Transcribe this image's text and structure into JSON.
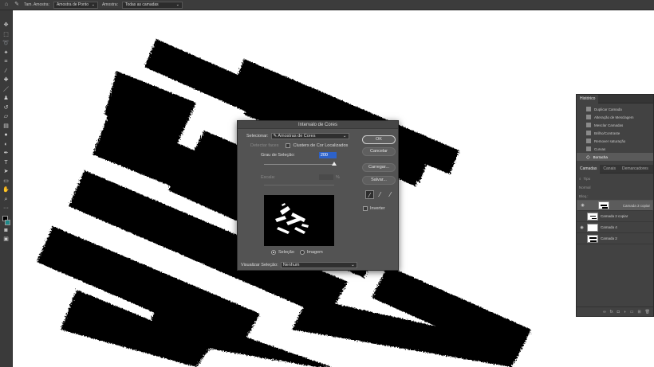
{
  "options_bar": {
    "sample_size_label": "Tam. Amostra:",
    "sample_size_value": "Amostra de Ponto",
    "sample_label": "Amostra:",
    "sample_value": "Todas as camadas"
  },
  "tools": [
    "move-icon",
    "marquee-icon",
    "lasso-icon",
    "quick-select-icon",
    "crop-icon",
    "eyedropper-icon",
    "healing-icon",
    "brush-icon",
    "stamp-icon",
    "history-brush-icon",
    "eraser-icon",
    "gradient-icon",
    "blur-icon",
    "dodge-icon",
    "pen-icon",
    "type-icon",
    "path-select-icon",
    "rectangle-icon",
    "hand-icon",
    "zoom-icon",
    "more-icon"
  ],
  "dialog": {
    "title": "Intervalo de Cores",
    "select_label": "Selecionar:",
    "select_value": "Amostras de Cores",
    "detect_faces": "Detectar faces",
    "localized_clusters": "Clusters de Cor Localizados",
    "fuzziness_label": "Grau de Seleção:",
    "fuzziness_value": "200",
    "range_label": "Escala:",
    "range_unit": "%",
    "fuzziness_level": 1.0,
    "radio_selection": "Seleção",
    "radio_image": "Imagem",
    "preview_label": "Visualizar Seleção:",
    "preview_value": "Nenhum",
    "ok": "OK",
    "cancel": "Cancelar",
    "load": "Carregar...",
    "save": "Salvar...",
    "invert": "Inverter"
  },
  "history": {
    "tab": "Histórico",
    "items": [
      "Duplicar Camada",
      "Alteração de Mesclagem",
      "Mesclar Camadas",
      "Brilho/Contraste",
      "Remover saturação",
      "Curvas",
      "Borracha"
    ]
  },
  "layers": {
    "tabs": [
      "Camadas",
      "Canais",
      "Demarcadores"
    ],
    "search": "Tipo",
    "blend": "Normal",
    "lock_label": "Bloq.:",
    "items": [
      {
        "name": "Camada 3 copiar",
        "visible": true
      },
      {
        "name": "Camada 2 copiar",
        "visible": false
      },
      {
        "name": "Camada 4",
        "visible": true
      },
      {
        "name": "Camada 2",
        "visible": false
      }
    ]
  }
}
